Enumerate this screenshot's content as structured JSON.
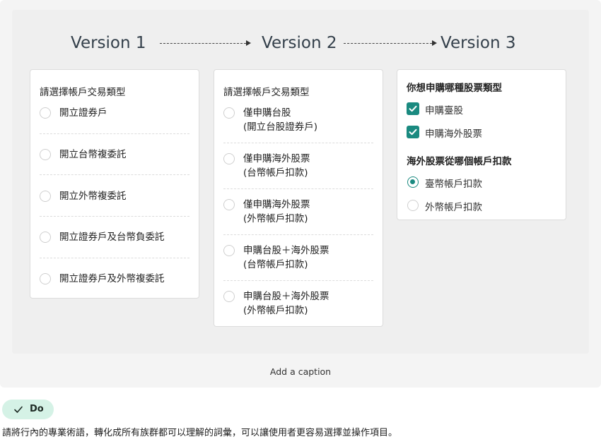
{
  "versions": [
    "Version 1",
    "Version 2",
    "Version 3"
  ],
  "v1": {
    "title": "請選擇帳戶交易類型",
    "options": [
      "開立證券戶",
      "開立台幣複委託",
      "開立外幣複委託",
      "開立證券戶及台幣負委託",
      "開立證券戶及外幣複委託"
    ]
  },
  "v2": {
    "title": "請選擇帳戶交易類型",
    "options": [
      {
        "line1": "僅申購台股",
        "line2": "(開立台股證券戶)"
      },
      {
        "line1": "僅申購海外股票",
        "line2": "(台幣帳戶扣款)"
      },
      {
        "line1": "僅申購海外股票",
        "line2": "(外幣帳戶扣款)"
      },
      {
        "line1": "申購台股＋海外股票",
        "line2": "(台幣帳戶扣款)"
      },
      {
        "line1": "申購台股＋海外股票",
        "line2": "(外幣帳戶扣款)"
      }
    ]
  },
  "v3": {
    "question1": "你想申購哪種股票類型",
    "checkboxes": [
      {
        "label": "申購臺股",
        "checked": true
      },
      {
        "label": "申購海外股票",
        "checked": true
      }
    ],
    "question2": "海外股票從哪個帳戶扣款",
    "radios": [
      {
        "label": "臺幣帳戶扣款",
        "selected": true
      },
      {
        "label": "外幣帳戶扣款",
        "selected": false
      }
    ]
  },
  "caption": "Add a caption",
  "badge": {
    "label": "Do",
    "icon": "check-icon",
    "color": "#d5f2e6"
  },
  "description": "請將行內的專業術語，轉化成所有族群都可以理解的詞彙，可以讓使用者更容易選擇並操作項目。",
  "colors": {
    "accent": "#1a8a80",
    "canvas": "#efefef"
  }
}
